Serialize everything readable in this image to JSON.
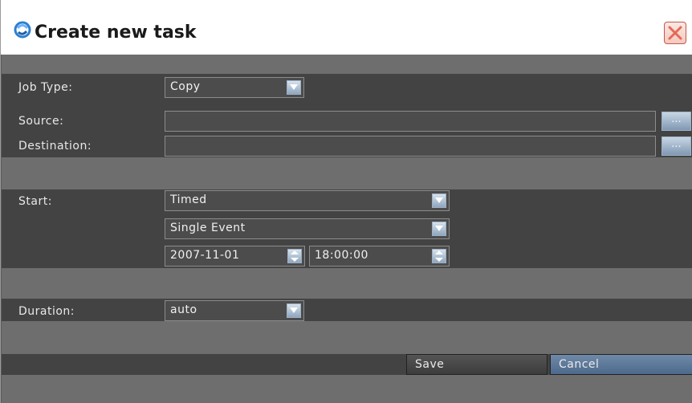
{
  "dialog": {
    "title": "Create new task",
    "close_icon": "close-x-icon",
    "title_icon": "task-icon",
    "accent": "#4d6a8c"
  },
  "form": {
    "job_type": {
      "label": "Job Type:",
      "value": "Copy"
    },
    "source": {
      "label": "Source:",
      "value": "",
      "browse_label": "..."
    },
    "destination": {
      "label": "Destination:",
      "value": "",
      "browse_label": "..."
    },
    "start": {
      "label": "Start:",
      "mode": "Timed",
      "recurrence": "Single Event",
      "date": "2007-11-01",
      "time": "18:00:00"
    },
    "duration": {
      "label": "Duration:",
      "value": "auto"
    }
  },
  "buttons": {
    "save": "Save",
    "cancel": "Cancel"
  }
}
